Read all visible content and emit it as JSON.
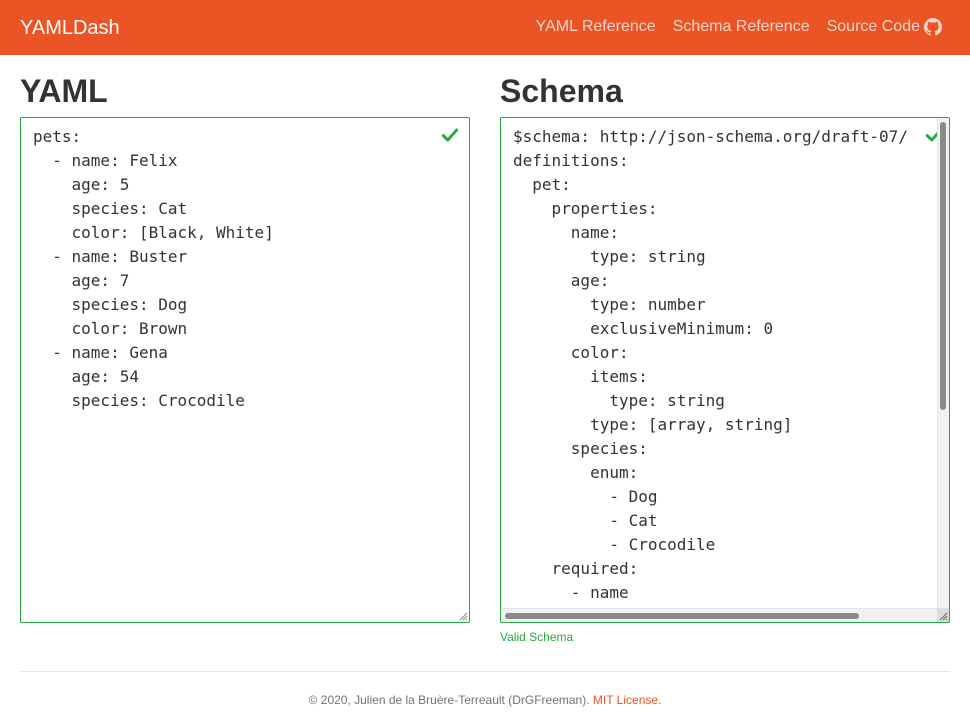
{
  "navbar": {
    "brand": "YAMLDash",
    "links": [
      "YAML Reference",
      "Schema Reference",
      "Source Code"
    ],
    "accent_color": "#eb5424",
    "source_icon": "github-icon"
  },
  "yaml_panel": {
    "title": "YAML",
    "content": "pets:\n  - name: Felix\n    age: 5\n    species: Cat\n    color: [Black, White]\n  - name: Buster\n    age: 7\n    species: Dog\n    color: Brown\n  - name: Gena\n    age: 54\n    species: Crocodile",
    "status_icon": "check-icon"
  },
  "schema_panel": {
    "title": "Schema",
    "content": "$schema: http://json-schema.org/draft-07/\ndefinitions:\n  pet:\n    properties:\n      name:\n        type: string\n      age:\n        type: number\n        exclusiveMinimum: 0\n      color:\n        items:\n          type: string\n        type: [array, string]\n      species:\n        enum:\n          - Dog\n          - Cat\n          - Crocodile\n    required:\n      - name",
    "status_icon": "check-icon",
    "validation_message": "Valid Schema",
    "valid_color": "#28a745"
  },
  "footer": {
    "text": "© 2020, Julien de la Bruère-Terreault (DrGFreeman).",
    "license_link": "MIT License",
    "trailing": "."
  }
}
